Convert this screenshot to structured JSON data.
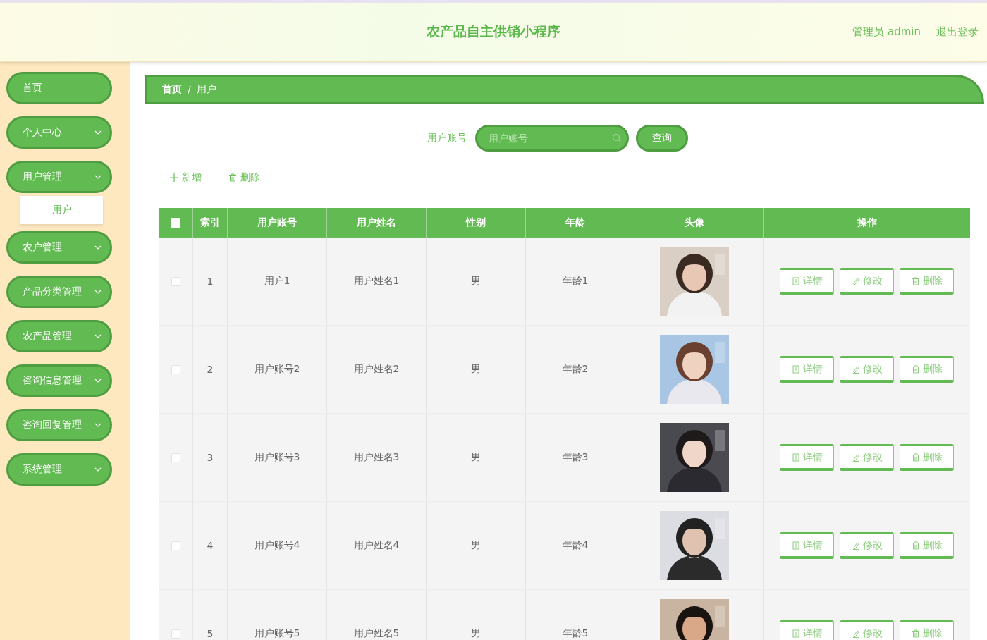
{
  "header": {
    "title": "农产品自主供销小程序",
    "user": "管理员 admin",
    "logout": "退出登录"
  },
  "sidebar": {
    "items": [
      {
        "label": "首页",
        "kind": "link"
      },
      {
        "label": "个人中心",
        "kind": "submenu"
      },
      {
        "label": "用户管理",
        "kind": "submenu",
        "children": [
          {
            "label": "用户"
          }
        ]
      },
      {
        "label": "农户管理",
        "kind": "submenu"
      },
      {
        "label": "产品分类管理",
        "kind": "submenu"
      },
      {
        "label": "农产品管理",
        "kind": "submenu"
      },
      {
        "label": "咨询信息管理",
        "kind": "submenu"
      },
      {
        "label": "咨询回复管理",
        "kind": "submenu"
      },
      {
        "label": "系统管理",
        "kind": "submenu"
      }
    ]
  },
  "breadcrumb": [
    "首页",
    "用户"
  ],
  "breadcrumb_separator": "/",
  "search": {
    "label": "用户账号",
    "placeholder": "用户账号",
    "button": "查询"
  },
  "actions": {
    "add": "新增",
    "delete": "删除"
  },
  "table": {
    "select_all_checked": false,
    "columns": [
      "索引",
      "用户账号",
      "用户姓名",
      "性别",
      "年龄",
      "头像",
      "操作"
    ],
    "rows": [
      {
        "checked": false,
        "index": "1",
        "account": "用户1",
        "name": "用户姓名1",
        "gender": "男",
        "age": "年龄1",
        "buttons": [
          "详情",
          "修改",
          "删除"
        ]
      },
      {
        "checked": false,
        "index": "2",
        "account": "用户账号2",
        "name": "用户姓名2",
        "gender": "男",
        "age": "年龄2",
        "buttons": [
          "详情",
          "修改",
          "删除"
        ]
      },
      {
        "checked": false,
        "index": "3",
        "account": "用户账号3",
        "name": "用户姓名3",
        "gender": "男",
        "age": "年龄3",
        "buttons": [
          "详情",
          "修改",
          "删除"
        ]
      },
      {
        "checked": false,
        "index": "4",
        "account": "用户账号4",
        "name": "用户姓名4",
        "gender": "男",
        "age": "年龄4",
        "buttons": [
          "详情",
          "修改",
          "删除"
        ]
      },
      {
        "checked": false,
        "index": "5",
        "account": "用户账号5",
        "name": "用户姓名5",
        "gender": "男",
        "age": "年龄5",
        "buttons": [
          "详情",
          "修改",
          "删除"
        ]
      }
    ]
  }
}
